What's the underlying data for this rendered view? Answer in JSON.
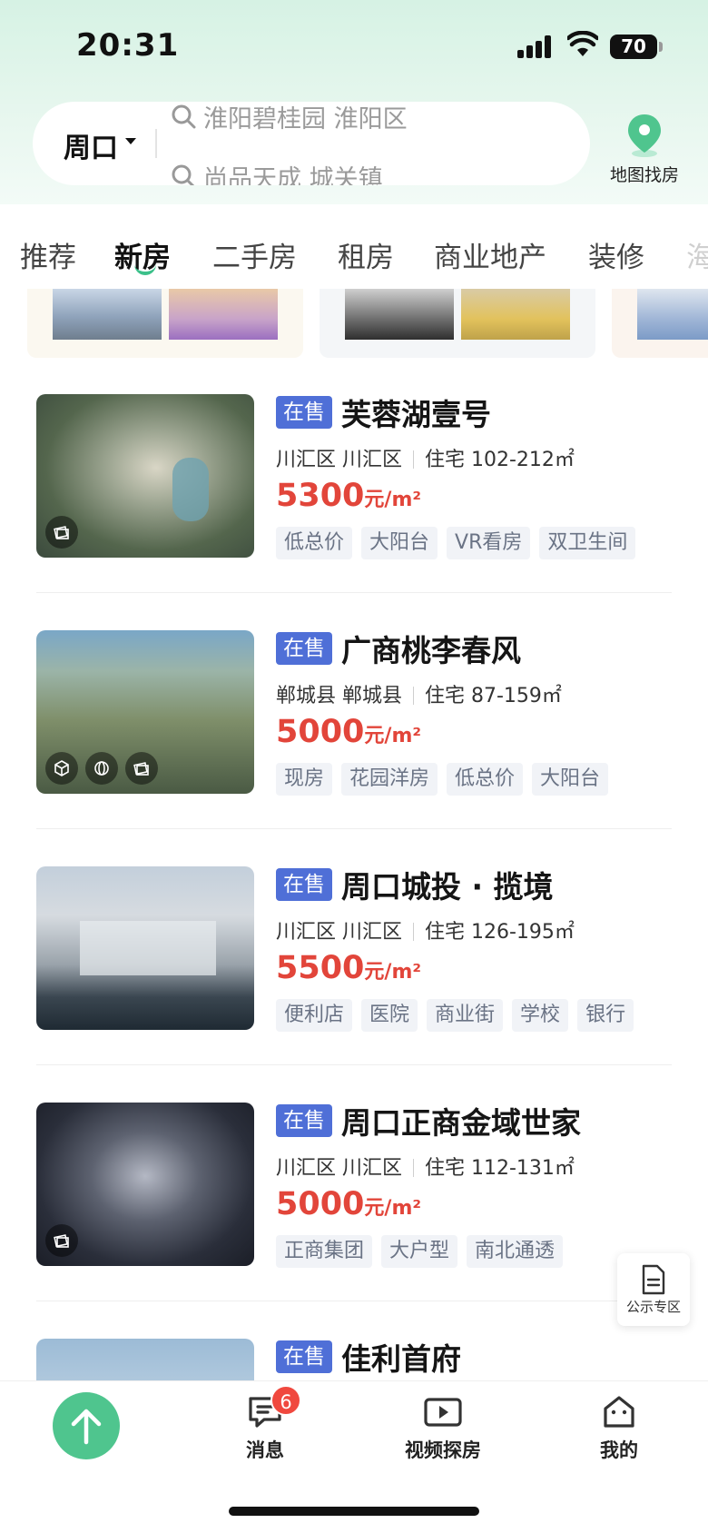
{
  "status_bar": {
    "time": "20:31",
    "battery": "70"
  },
  "search": {
    "city": "周口",
    "suggestions": [
      "淮阳碧桂园 淮阳区",
      "尚品天成 城关镇"
    ]
  },
  "map_button": {
    "label": "地图找房"
  },
  "tabs": [
    {
      "label": "推荐",
      "active": false
    },
    {
      "label": "新房",
      "active": true
    },
    {
      "label": "二手房",
      "active": false
    },
    {
      "label": "租房",
      "active": false
    },
    {
      "label": "商业地产",
      "active": false
    },
    {
      "label": "装修",
      "active": false
    },
    {
      "label": "海",
      "active": false
    }
  ],
  "listings": [
    {
      "status": "在售",
      "name": "芙蓉湖壹号",
      "district": "川汇区 川汇区",
      "type_area": "住宅 102-212㎡",
      "price": "5300",
      "price_unit": "元/m²",
      "tags": [
        "低总价",
        "大阳台",
        "VR看房",
        "双卫生间"
      ]
    },
    {
      "status": "在售",
      "name": "广商桃李春风",
      "district": "郸城县 郸城县",
      "type_area": "住宅 87-159㎡",
      "price": "5000",
      "price_unit": "元/m²",
      "tags": [
        "现房",
        "花园洋房",
        "低总价",
        "大阳台"
      ]
    },
    {
      "status": "在售",
      "name": "周口城投 · 揽境",
      "district": "川汇区 川汇区",
      "type_area": "住宅 126-195㎡",
      "price": "5500",
      "price_unit": "元/m²",
      "tags": [
        "便利店",
        "医院",
        "商业街",
        "学校",
        "银行"
      ]
    },
    {
      "status": "在售",
      "name": "周口正商金域世家",
      "district": "川汇区 川汇区",
      "type_area": "住宅 112-131㎡",
      "price": "5000",
      "price_unit": "元/m²",
      "tags": [
        "正商集团",
        "大户型",
        "南北通透"
      ]
    },
    {
      "status": "在售",
      "name": "佳利首府"
    }
  ],
  "float_button": {
    "label": "公示专区"
  },
  "bottom_nav": {
    "messages": {
      "label": "消息",
      "badge": "6"
    },
    "video": {
      "label": "视频探房"
    },
    "mine": {
      "label": "我的"
    }
  },
  "colors": {
    "accent_green": "#4fc58e",
    "sale_badge": "#4f6fd7",
    "price_red": "#e2453a",
    "badge_red": "#f0483e"
  }
}
